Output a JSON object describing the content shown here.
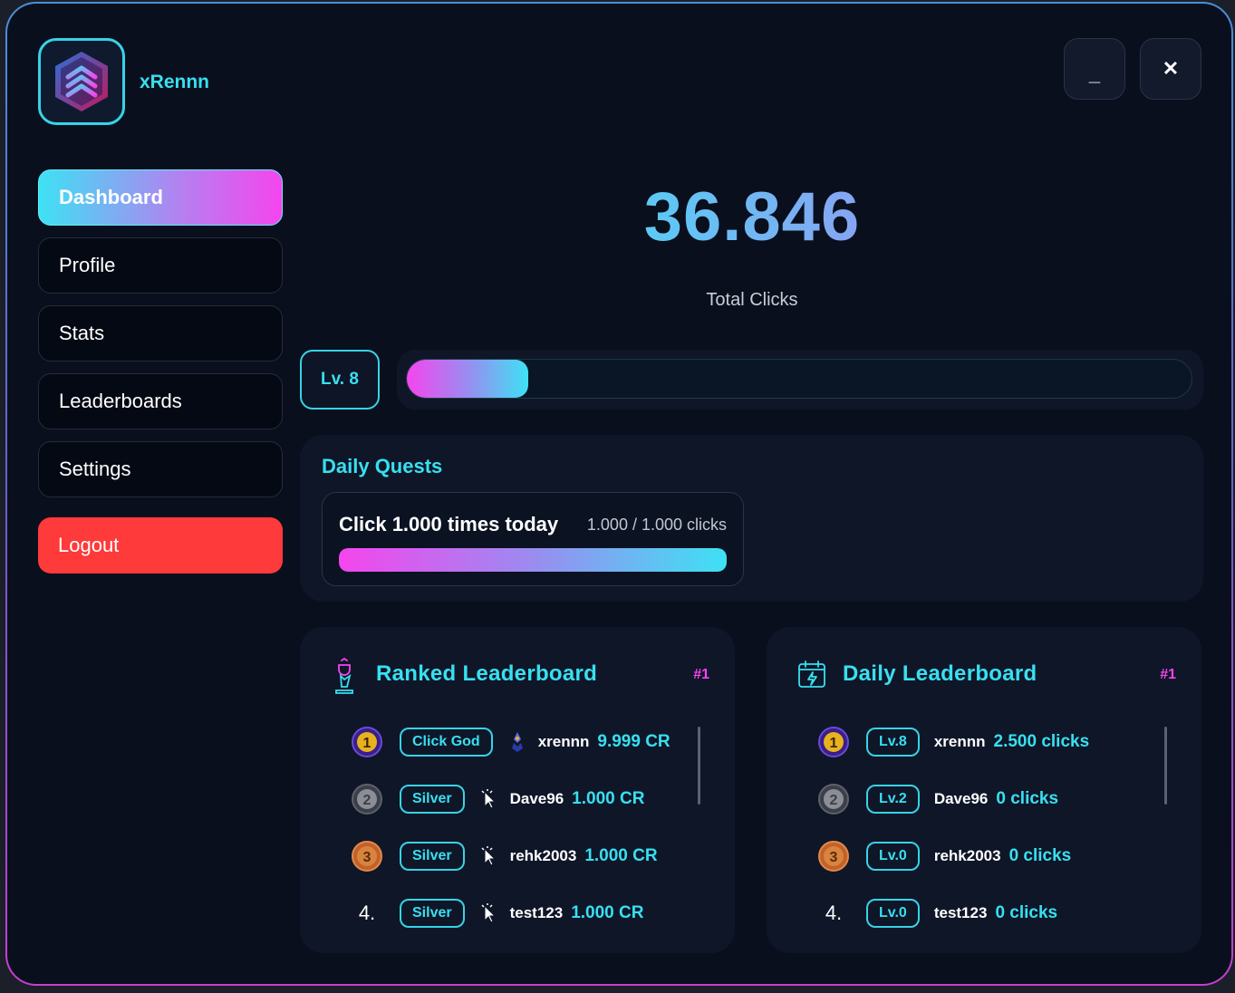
{
  "user": {
    "name": "xRennn"
  },
  "window": {
    "minimize": "_",
    "close": "✕"
  },
  "nav": {
    "dashboard": "Dashboard",
    "profile": "Profile",
    "stats": "Stats",
    "leaderboards": "Leaderboards",
    "settings": "Settings",
    "logout": "Logout"
  },
  "clicks": {
    "total": "36.846",
    "label": "Total Clicks"
  },
  "level": {
    "label": "Lv. 8",
    "progress_fraction": 0.155
  },
  "quests": {
    "title": "Daily Quests",
    "items": [
      {
        "name": "Click 1.000 times today",
        "progress": "1.000 / 1.000 clicks",
        "fraction": 1.0
      }
    ]
  },
  "ranked": {
    "title": "Ranked Leaderboard",
    "own_rank": "#1",
    "rows": [
      {
        "medal": "gold",
        "place": "1",
        "tag": "Click God",
        "icon": "sword-rank-icon",
        "player": "xrennn",
        "score": "9.999 CR"
      },
      {
        "medal": "silver",
        "place": "2",
        "tag": "Silver",
        "icon": "cursor-icon",
        "player": "Dave96",
        "score": "1.000 CR"
      },
      {
        "medal": "bronze",
        "place": "3",
        "tag": "Silver",
        "icon": "cursor-icon",
        "player": "rehk2003",
        "score": "1.000 CR"
      },
      {
        "medal": "none",
        "place": "4.",
        "tag": "Silver",
        "icon": "cursor-icon",
        "player": "test123",
        "score": "1.000 CR"
      }
    ]
  },
  "daily": {
    "title": "Daily Leaderboard",
    "own_rank": "#1",
    "rows": [
      {
        "medal": "gold",
        "place": "1",
        "tag": "Lv.8",
        "player": "xrennn",
        "score": "2.500 clicks"
      },
      {
        "medal": "silver",
        "place": "2",
        "tag": "Lv.2",
        "player": "Dave96",
        "score": "0 clicks"
      },
      {
        "medal": "bronze",
        "place": "3",
        "tag": "Lv.0",
        "player": "rehk2003",
        "score": "0 clicks"
      },
      {
        "medal": "none",
        "place": "4.",
        "tag": "Lv.0",
        "player": "test123",
        "score": "0 clicks"
      }
    ]
  },
  "colors": {
    "accent_cyan": "#37e0f0",
    "accent_magenta": "#f545ee",
    "logout_red": "#fe3a3a",
    "background": "#0a0f1e",
    "panel": "#0f1628"
  }
}
